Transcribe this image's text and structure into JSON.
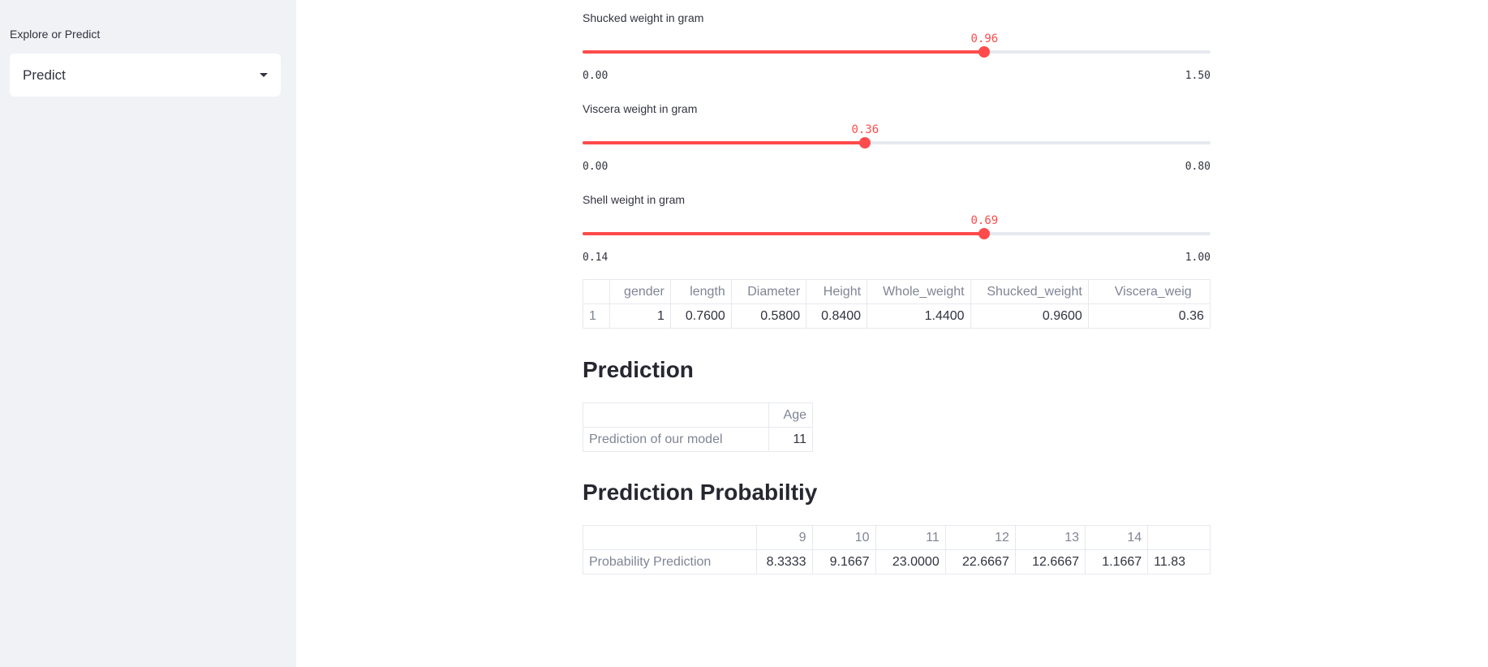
{
  "sidebar": {
    "label": "Explore or Predict",
    "select_value": "Predict"
  },
  "sliders": [
    {
      "label": "Shucked weight in gram",
      "value": "0.96",
      "min": "0.00",
      "max": "1.50",
      "fraction": 0.64
    },
    {
      "label": "Viscera weight in gram",
      "value": "0.36",
      "min": "0.00",
      "max": "0.80",
      "fraction": 0.45
    },
    {
      "label": "Shell weight in gram",
      "value": "0.69",
      "min": "0.14",
      "max": "1.00",
      "fraction": 0.64
    }
  ],
  "input_table": {
    "columns": [
      "",
      "gender",
      "length",
      "Diameter",
      "Height",
      "Whole_weight",
      "Shucked_weight",
      "Viscera_weig"
    ],
    "row": [
      "1",
      "1",
      "0.7600",
      "0.5800",
      "0.8400",
      "1.4400",
      "0.9600",
      "0.36"
    ]
  },
  "prediction": {
    "heading": "Prediction",
    "column": "Age",
    "row_label": "Prediction of our model",
    "value": "11"
  },
  "probability": {
    "heading": "Prediction Probabiltiy",
    "columns": [
      "",
      "9",
      "10",
      "11",
      "12",
      "13",
      "14",
      ""
    ],
    "row": [
      "Probability Prediction",
      "8.3333",
      "9.1667",
      "23.0000",
      "22.6667",
      "12.6667",
      "1.1667",
      "11.83"
    ]
  }
}
